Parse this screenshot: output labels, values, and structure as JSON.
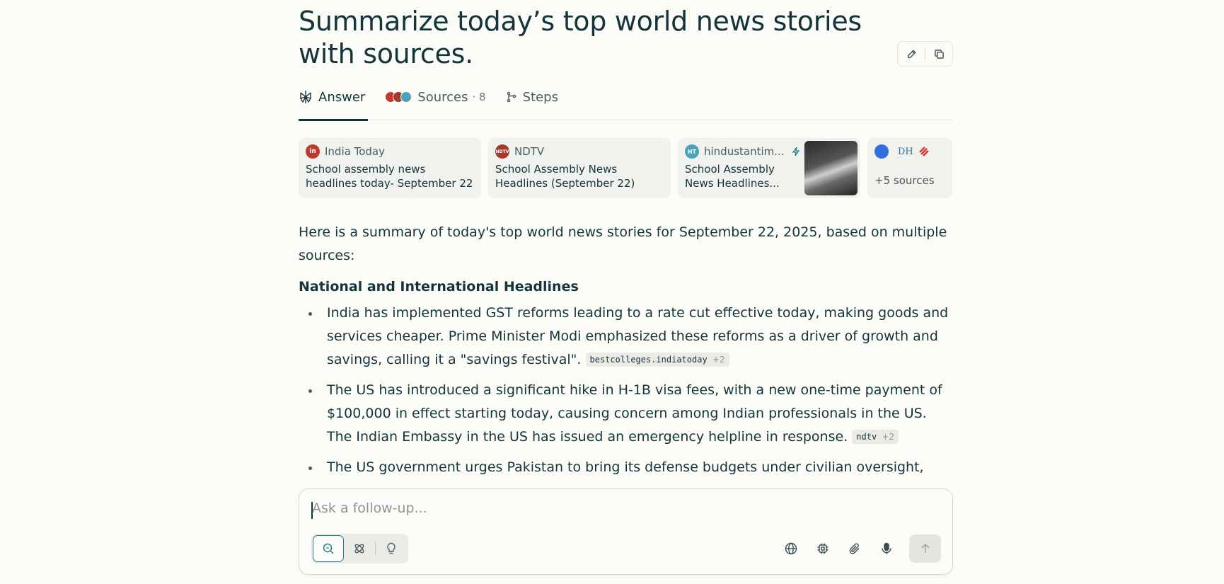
{
  "query": {
    "title": "Summarize today’s top world news stories with sources."
  },
  "tabs": {
    "answer": "Answer",
    "sources": "Sources",
    "sources_count": "· 8",
    "steps": "Steps"
  },
  "source_cards": [
    {
      "site": "India Today",
      "headline": "School assembly news headlines today- September 22",
      "fav_label": "in",
      "fav_color": "#c0392b"
    },
    {
      "site": "NDTV",
      "headline": "School Assembly News Headlines (September 22)",
      "fav_label": "NDTV",
      "fav_color": "#a63a2c"
    },
    {
      "site": "hindustantim...",
      "headline": "School Assembly News Headlines...",
      "fav_label": "HT",
      "fav_color": "#4aa3b8"
    }
  ],
  "more_sources": {
    "label": "+5 sources",
    "icon_dh": "DH"
  },
  "answer": {
    "intro": "Here is a summary of today's top world news stories for September 22, 2025, based on multiple sources:",
    "heading": "National and International Headlines",
    "bullets": [
      {
        "text": "India has implemented GST reforms leading to a rate cut effective today, making goods and services cheaper. Prime Minister Modi emphasized these reforms as a driver of growth and savings, calling it a \"savings festival\".",
        "cite": "bestcolleges.indiatoday",
        "cite_more": "+2"
      },
      {
        "text": "The US has introduced a significant hike in H-1B visa fees, with a new one-time payment of $100,000 in effect starting today, causing concern among Indian professionals in the US. The Indian Embassy in the US has issued an emergency helpline in response.",
        "cite": "ndtv",
        "cite_more": "+2"
      },
      {
        "text": "The US government urges Pakistan to bring its defense budgets under civilian oversight,",
        "cite": "",
        "cite_more": ""
      }
    ]
  },
  "composer": {
    "placeholder": "Ask a follow-up..."
  },
  "colors": {
    "accent": "#21808d",
    "text": "#13343b",
    "background": "#fcfcf9"
  }
}
